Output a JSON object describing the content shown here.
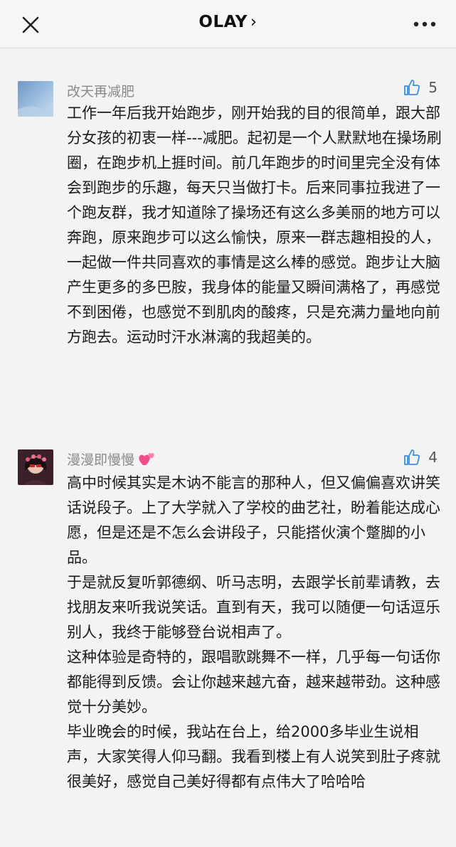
{
  "header": {
    "title": "OLAY",
    "chevron": "›",
    "close_icon": "close-icon",
    "more_icon": "more-dots-icon"
  },
  "comments": [
    {
      "name": "改天再减肥",
      "likes": "5",
      "avatar": "sky-photo",
      "paragraphs": [
        "工作一年后我开始跑步，刚开始我的目的很简单，跟大部分女孩的初衷一样---减肥。起初是一个人默默地在操场刷圈，在跑步机上捱时间。前几年跑步的时间里完全没有体会到跑步的乐趣，每天只当做打卡。后来同事拉我进了一个跑友群，我才知道除了操场还有这么多美丽的地方可以奔跑，原来跑步可以这么愉快，原来一群志趣相投的人，一起做一件共同喜欢的事情是这么棒的感觉。跑步让大脑产生更多的多巴胺，我身体的能量又瞬间满格了，再感觉不到困倦，也感觉不到肌肉的酸疼，只是充满力量地向前方跑去。运动时汗水淋漓的我超美的。"
      ]
    },
    {
      "name": "漫漫即慢慢",
      "name_emoji": "two-hearts-icon",
      "likes": "4",
      "avatar": "girl-photo",
      "paragraphs": [
        "高中时候其实是木讷不能言的那种人，但又偏偏喜欢讲笑话说段子。上了大学就入了学校的曲艺社，盼着能达成心愿，但是还是不怎么会讲段子，只能搭伙演个蹩脚的小品。",
        "于是就反复听郭德纲、听马志明，去跟学长前辈请教，去找朋友来听我说笑话。直到有天，我可以随便一句话逗乐别人，我终于能够登台说相声了。",
        "这种体验是奇特的，跟唱歌跳舞不一样，几乎每一句话你都能得到反馈。会让你越来越亢奋，越来越带劲。这种感觉十分美妙。",
        "毕业晚会的时候，我站在台上，给2000多毕业生说相声，大家笑得人仰马翻。我看到楼上有人说笑到肚子疼就很美好，感觉自己美好得都有点伟大了哈哈哈"
      ]
    }
  ],
  "colors": {
    "background": "#f3f3f3",
    "accent": "#3b8fe0",
    "name": "#8a8a8a",
    "text": "#1a1a1a"
  }
}
